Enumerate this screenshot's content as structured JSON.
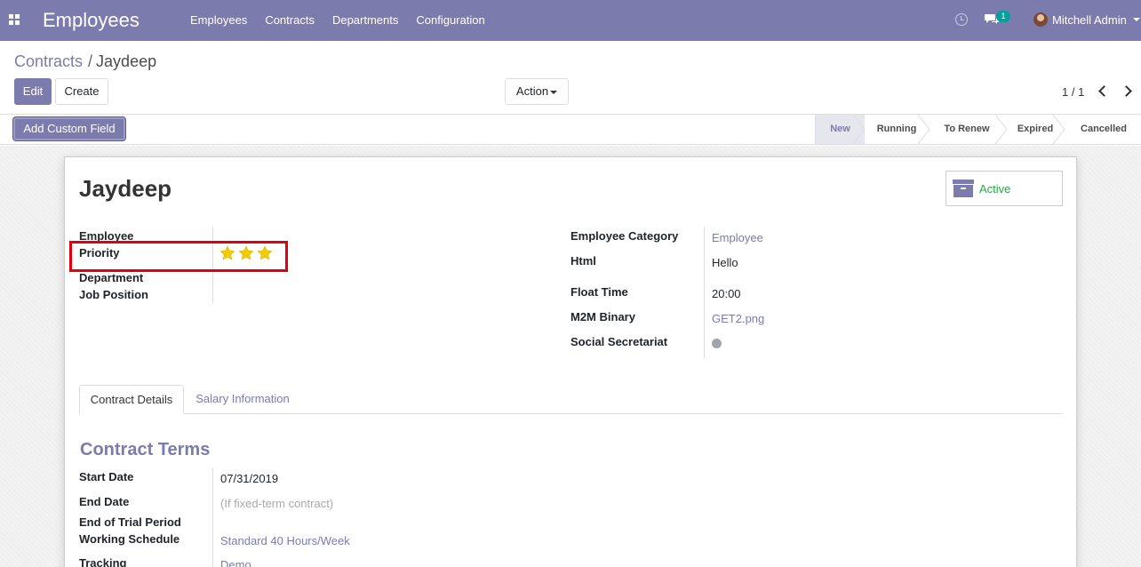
{
  "navbar": {
    "app_name": "Employees",
    "menu": [
      "Employees",
      "Contracts",
      "Departments",
      "Configuration"
    ],
    "chat_count": "1",
    "user_name": "Mitchell Admin",
    "icons": [
      "apps-icon",
      "clock-icon",
      "chat-icon",
      "avatar",
      "chevron-down-icon"
    ]
  },
  "breadcrumb": {
    "parent": "Contracts",
    "separator": "/",
    "current": "Jaydeep"
  },
  "toolbar": {
    "edit_label": "Edit",
    "create_label": "Create",
    "action_label": "Action"
  },
  "pager": {
    "value": "1 / 1"
  },
  "statusbar": {
    "custom_field_label": "Add Custom Field",
    "stages": [
      "New",
      "Running",
      "To Renew",
      "Expired",
      "Cancelled"
    ],
    "active_stage": "New"
  },
  "record": {
    "title": "Jaydeep",
    "active_label": "Active",
    "left_fields": {
      "employee": "Employee",
      "priority": "Priority",
      "department": "Department",
      "job_position": "Job Position"
    },
    "priority_stars": 3,
    "right_fields": [
      {
        "label": "Employee Category",
        "value": "Employee"
      },
      {
        "label": "Html",
        "value": "Hello"
      },
      {
        "label": "Float Time",
        "value": "20:00"
      },
      {
        "label": "M2M Binary",
        "value": "GET2.png"
      },
      {
        "label": "Social Secretariat",
        "value": ""
      }
    ]
  },
  "tabs": [
    "Contract Details",
    "Salary Information"
  ],
  "contract_terms": {
    "title": "Contract Terms",
    "start_date_label": "Start Date",
    "start_date": "07/31/2019",
    "end_date_label": "End Date",
    "end_date_placeholder": "(If fixed-term contract)",
    "trial_label": "End of Trial Period",
    "schedule_label": "Working Schedule",
    "schedule": "Standard 40 Hours/Week",
    "tracking_label": "Tracking",
    "tracking": "Demo"
  },
  "colors": {
    "brand": "#7c7bad",
    "active_green": "#28a745",
    "star": "#f3cc00",
    "highlight": "#e0000f"
  }
}
